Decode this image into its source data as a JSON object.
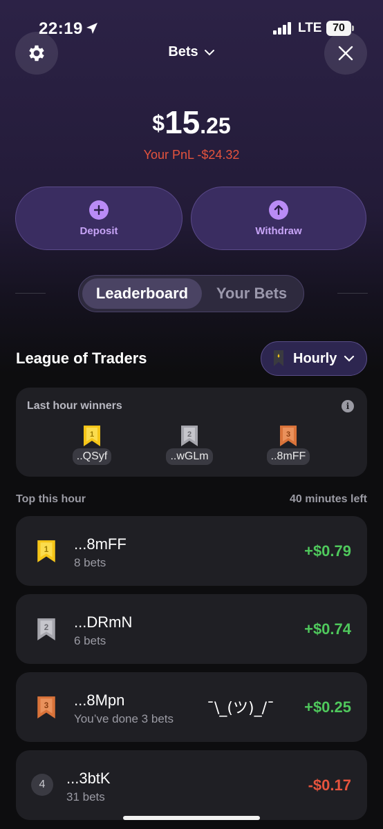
{
  "status_bar": {
    "time": "22:19",
    "network": "LTE",
    "battery": "70"
  },
  "header": {
    "title": "Bets"
  },
  "balance": {
    "currency": "$",
    "integer": "15",
    "decimal": ".25"
  },
  "pnl": {
    "text": "Your PnL -$24.32"
  },
  "actions": {
    "deposit_label": "Deposit",
    "withdraw_label": "Withdraw"
  },
  "tabs": {
    "leaderboard": "Leaderboard",
    "your_bets": "Your Bets",
    "active": "Leaderboard"
  },
  "league": {
    "title": "League of Traders",
    "period_selector": "Hourly"
  },
  "winners": {
    "title": "Last hour winners",
    "list": [
      {
        "rank": "1",
        "name": "..QSyf"
      },
      {
        "rank": "2",
        "name": "..wGLm"
      },
      {
        "rank": "3",
        "name": "..8mFF"
      }
    ]
  },
  "top_hour": {
    "title": "Top this hour",
    "time_left": "40 minutes left"
  },
  "rows": [
    {
      "rank": "1",
      "name": "...8mFF",
      "sub": "8 bets",
      "amount": "+$0.79",
      "extra": ""
    },
    {
      "rank": "2",
      "name": "...DRmN",
      "sub": "6 bets",
      "amount": "+$0.74",
      "extra": ""
    },
    {
      "rank": "3",
      "name": "...8Mpn",
      "sub": "You’ve done 3 bets",
      "amount": "+$0.25",
      "extra": "¯\\_(ツ)_/¯"
    },
    {
      "rank": "4",
      "name": "...3btK",
      "sub": "31 bets",
      "amount": "-$0.17",
      "extra": ""
    }
  ],
  "colors": {
    "accent": "#b98bf5",
    "positive": "#4fc85c",
    "negative": "#e5533d",
    "gold": "#f5c518",
    "silver": "#a6a6ad",
    "bronze": "#d9733a"
  }
}
